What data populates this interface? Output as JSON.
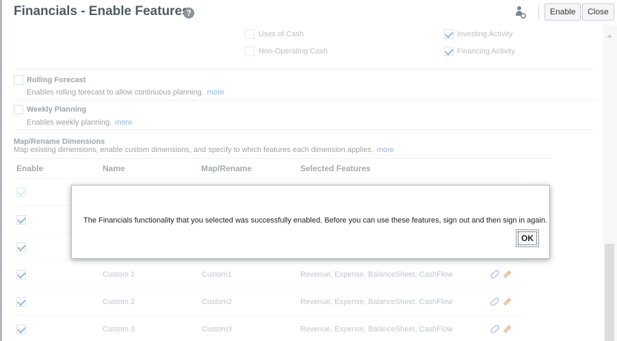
{
  "header": {
    "title": "Financials - Enable Features",
    "enable_label": "Enable",
    "close_label": "Close"
  },
  "cash_options": {
    "uses_of_cash": {
      "label": "Uses of Cash",
      "checked": false
    },
    "non_operating_cash": {
      "label": "Non-Operating Cash",
      "checked": false
    },
    "investing_activity": {
      "label": "Investing Activity",
      "checked": true
    },
    "financing_activity": {
      "label": "Financing Activity",
      "checked": true
    }
  },
  "features": {
    "rolling_forecast": {
      "label": "Rolling Forecast",
      "description": "Enables rolling forecast to allow continuous planning.",
      "more": "more",
      "checked": false
    },
    "weekly_planning": {
      "label": "Weekly Planning",
      "description": "Enables weekly planning.",
      "more": "more",
      "checked": false
    }
  },
  "map_rename": {
    "title": "Map/Rename Dimensions",
    "description": "Map existing dimensions, enable custom dimensions, and specify to which features each dimension applies.",
    "more": "more"
  },
  "table": {
    "columns": [
      "Enable",
      "Name",
      "Map/Rename",
      "Selected Features"
    ],
    "rows": [
      {
        "checked": true,
        "name": "Custom 1",
        "map": "Custom1",
        "features": "Revenue, Expense, BalanceSheet, CashFlow"
      },
      {
        "checked": true,
        "name": "Custom 2",
        "map": "Custom2",
        "features": "Revenue, Expense, BalanceSheet, CashFlow"
      },
      {
        "checked": true,
        "name": "Custom 3",
        "map": "Custom3",
        "features": "Revenue, Expense, BalanceSheet, CashFlow"
      }
    ]
  },
  "dialog": {
    "message": "The Financials functionality that you selected was successfully enabled. Before you can use these features, sign out and then sign in again.",
    "ok_label": "OK"
  },
  "icons": {
    "help": "help-icon",
    "user": "user-gear-icon",
    "attach": "paperclip-icon",
    "edit": "pencil-icon"
  },
  "colors": {
    "accent": "#3a7dc9",
    "link": "#2c7fc8",
    "title": "#4e5b66"
  }
}
